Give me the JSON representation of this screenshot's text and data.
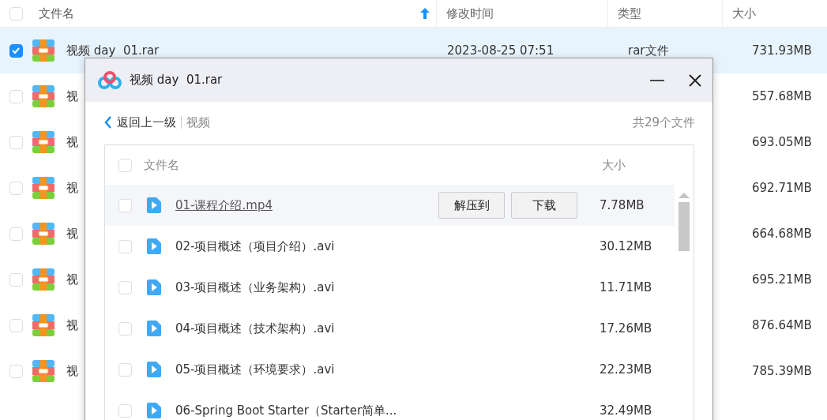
{
  "file_list": {
    "all_checked": false,
    "columns": [
      {
        "label": "文件名",
        "sorted": true
      },
      {
        "label": "修改时间",
        "sorted": false
      },
      {
        "label": "类型",
        "sorted": false
      },
      {
        "label": "大小",
        "sorted": false
      }
    ],
    "rows": [
      {
        "name": "视频 day  01.rar",
        "modified": "2023-08-25 07:51",
        "type": "rar文件",
        "size": "731.93MB",
        "checked": true
      },
      {
        "name": "视",
        "size": "557.68MB",
        "checked": false
      },
      {
        "name": "视",
        "size": "693.05MB",
        "checked": false
      },
      {
        "name": "视",
        "size": "692.71MB",
        "checked": false
      },
      {
        "name": "视",
        "size": "664.68MB",
        "checked": false
      },
      {
        "name": "视",
        "size": "695.21MB",
        "checked": false
      },
      {
        "name": "视",
        "size": "876.64MB",
        "checked": false
      },
      {
        "name": "视",
        "size": "785.39MB",
        "checked": false
      }
    ]
  },
  "dialog": {
    "title": "视频 day  01.rar",
    "back_link": "返回上一级",
    "folder": "视频",
    "file_count": "共29个文件",
    "all_checked": false,
    "columns": [
      "文件名",
      "大小"
    ],
    "files": [
      {
        "name": "01-课程介绍.mp4",
        "size": "7.78MB",
        "hovered": true,
        "actions": [
          "解压到",
          "下载"
        ]
      },
      {
        "name": "02-项目概述（项目介绍）.avi",
        "size": "30.12MB",
        "hovered": false
      },
      {
        "name": "03-项目概述（业务架构）.avi",
        "size": "11.71MB",
        "hovered": false
      },
      {
        "name": "04-项目概述（技术架构）.avi",
        "size": "17.26MB",
        "hovered": false
      },
      {
        "name": "05-项目概述（环境要求）.avi",
        "size": "22.23MB",
        "hovered": false
      },
      {
        "name": "06-Spring Boot Starter（Starter简单...",
        "size": "32.49MB",
        "hovered": false
      }
    ]
  }
}
